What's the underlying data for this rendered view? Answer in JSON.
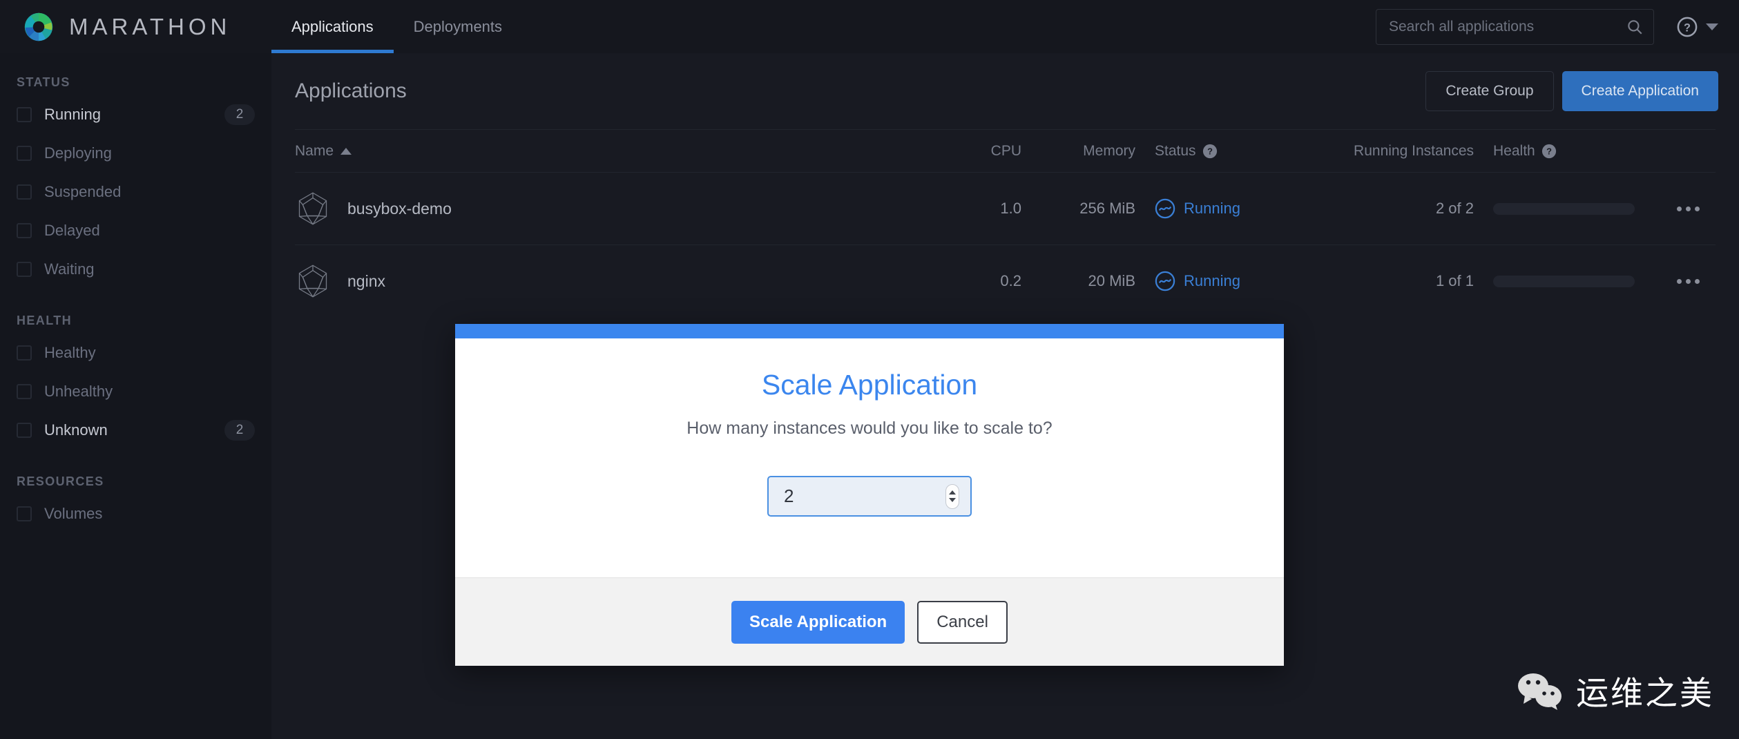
{
  "brand": {
    "name": "MARATHON",
    "logo_icon": "marathon-donut-logo"
  },
  "topnav": {
    "tabs": [
      {
        "label": "Applications",
        "active": true
      },
      {
        "label": "Deployments",
        "active": false
      }
    ],
    "search": {
      "placeholder": "Search all applications",
      "value": "",
      "icon": "search-icon"
    },
    "help": {
      "icon": "help-circle-icon",
      "caret": "chevron-down-icon"
    }
  },
  "sidebar": {
    "groups": [
      {
        "title": "STATUS",
        "items": [
          {
            "label": "Running",
            "count": "2"
          },
          {
            "label": "Deploying",
            "count": ""
          },
          {
            "label": "Suspended",
            "count": ""
          },
          {
            "label": "Delayed",
            "count": ""
          },
          {
            "label": "Waiting",
            "count": ""
          }
        ]
      },
      {
        "title": "HEALTH",
        "items": [
          {
            "label": "Healthy",
            "count": ""
          },
          {
            "label": "Unhealthy",
            "count": ""
          },
          {
            "label": "Unknown",
            "count": "2"
          }
        ]
      },
      {
        "title": "RESOURCES",
        "items": [
          {
            "label": "Volumes",
            "count": ""
          }
        ]
      }
    ]
  },
  "main": {
    "page_title": "Applications",
    "create_group_label": "Create Group",
    "create_application_label": "Create Application",
    "table": {
      "columns": {
        "name": "Name",
        "cpu": "CPU",
        "memory": "Memory",
        "status": "Status",
        "running_instances": "Running Instances",
        "health": "Health"
      },
      "sort": {
        "column": "Name",
        "direction": "asc"
      },
      "rows": [
        {
          "name": "busybox-demo",
          "cpu": "1.0",
          "memory": "256 MiB",
          "status": "Running",
          "running_instances": "2 of 2"
        },
        {
          "name": "nginx",
          "cpu": "0.2",
          "memory": "20 MiB",
          "status": "Running",
          "running_instances": "1 of 1"
        }
      ]
    }
  },
  "modal": {
    "title": "Scale Application",
    "subtitle": "How many instances would you like to scale to?",
    "instances_value": "2",
    "confirm_label": "Scale Application",
    "cancel_label": "Cancel"
  },
  "watermark": {
    "text": "运维之美",
    "icon": "wechat-icon"
  },
  "colors": {
    "accent_blue": "#3b86ee",
    "primary_button": "#2e6fbd",
    "status_running": "#3a7fd5",
    "sidebar_bg": "#14161d",
    "content_bg": "#181a22",
    "topbar_bg": "#15171e"
  }
}
